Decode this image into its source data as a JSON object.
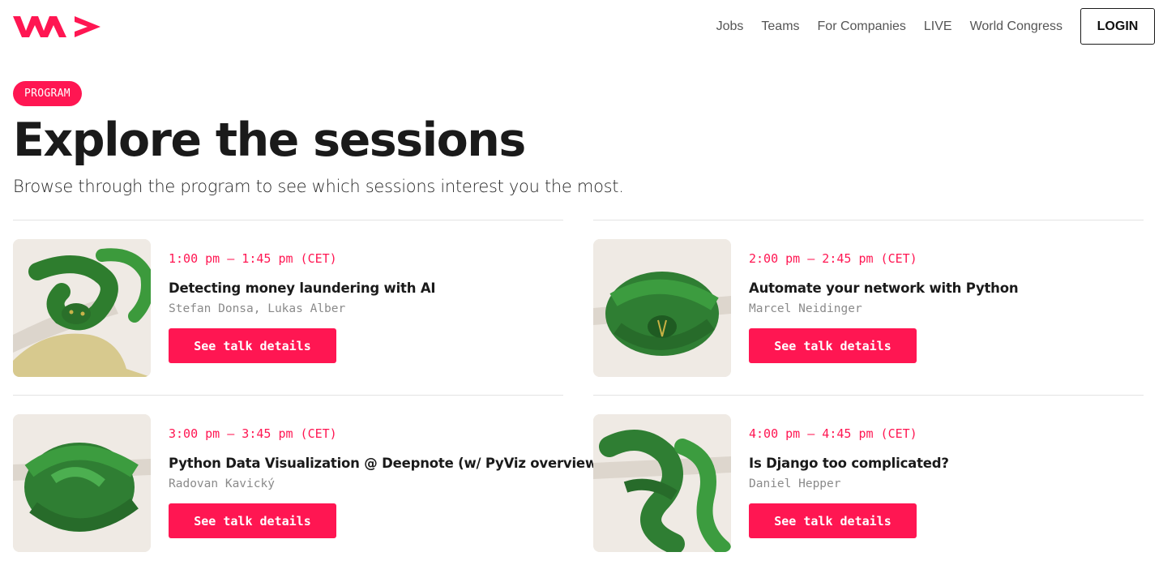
{
  "brand": {
    "accent": "#ff1652",
    "logo_name": "wearedevelopers-logo"
  },
  "nav": {
    "links": [
      "Jobs",
      "Teams",
      "For Companies",
      "LIVE",
      "World Congress"
    ],
    "login_label": "LOGIN"
  },
  "hero": {
    "badge": "PROGRAM",
    "title": "Explore the sessions",
    "subtitle": "Browse through the program to see which sessions interest you the most."
  },
  "sessions": [
    {
      "time": "1:00 pm – 1:45 pm (CET)",
      "title": "Detecting money laundering with AI",
      "speakers": "Stefan Donsa, Lukas Alber",
      "button_label": "See talk details"
    },
    {
      "time": "2:00 pm – 2:45 pm (CET)",
      "title": "Automate your network with Python",
      "speakers": "Marcel Neidinger",
      "button_label": "See talk details"
    },
    {
      "time": "3:00 pm – 3:45 pm (CET)",
      "title": "Python Data Visualization @ Deepnote (w/ PyViz overview)",
      "speakers": "Radovan Kavický",
      "button_label": "See talk details"
    },
    {
      "time": "4:00 pm – 4:45 pm (CET)",
      "title": "Is Django too complicated?",
      "speakers": "Daniel Hepper",
      "button_label": "See talk details"
    }
  ]
}
